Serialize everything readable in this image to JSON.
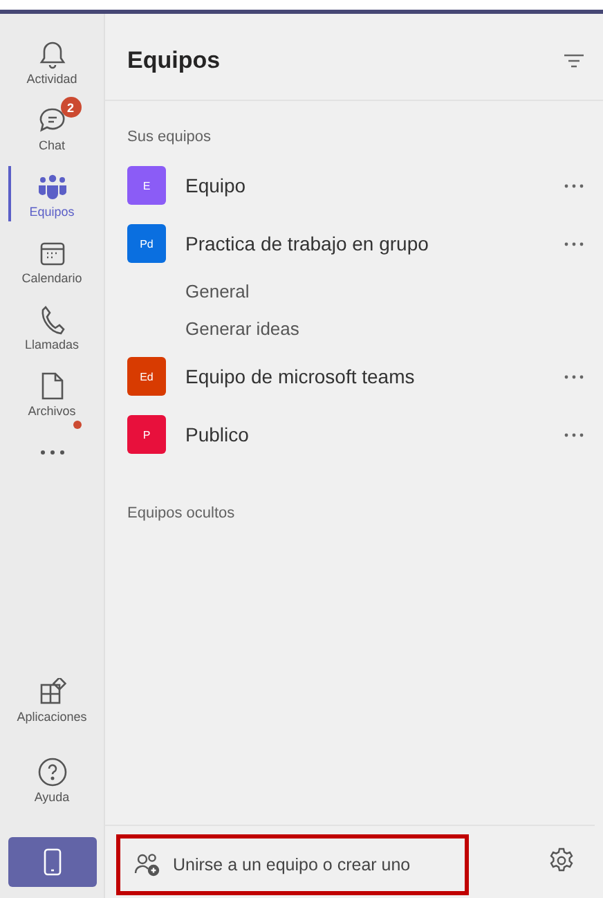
{
  "rail": {
    "items": [
      {
        "kind": "activity",
        "label": "Actividad",
        "selected": false
      },
      {
        "kind": "chat",
        "label": "Chat",
        "selected": false,
        "badge": "2"
      },
      {
        "kind": "teams",
        "label": "Equipos",
        "selected": true
      },
      {
        "kind": "calendar",
        "label": "Calendario",
        "selected": false
      },
      {
        "kind": "calls",
        "label": "Llamadas",
        "selected": false
      },
      {
        "kind": "files",
        "label": "Archivos",
        "selected": false
      },
      {
        "kind": "more",
        "selected": false,
        "dot": true
      }
    ],
    "bottom_items": [
      {
        "kind": "apps",
        "label": "Aplicaciones"
      },
      {
        "kind": "help",
        "label": "Ayuda"
      },
      {
        "kind": "device"
      }
    ]
  },
  "panel": {
    "title": "Equipos",
    "section": "Sus equipos",
    "teams": [
      {
        "initials": "E",
        "color": "#8b5cf6",
        "name": "Equipo"
      },
      {
        "initials": "Pd",
        "color": "#0a6fe0",
        "name": "Practica de trabajo en grupo",
        "channels": [
          "General",
          "Generar ideas"
        ]
      },
      {
        "initials": "Ed",
        "color": "#d83b01",
        "name": "Equipo de microsoft teams"
      },
      {
        "initials": "P",
        "color": "#e8103c",
        "name": "Publico"
      }
    ],
    "hidden_section": "Equipos ocultos",
    "join_button": {
      "label": "Unirse a un equipo o crear uno",
      "highlighted": true
    }
  }
}
